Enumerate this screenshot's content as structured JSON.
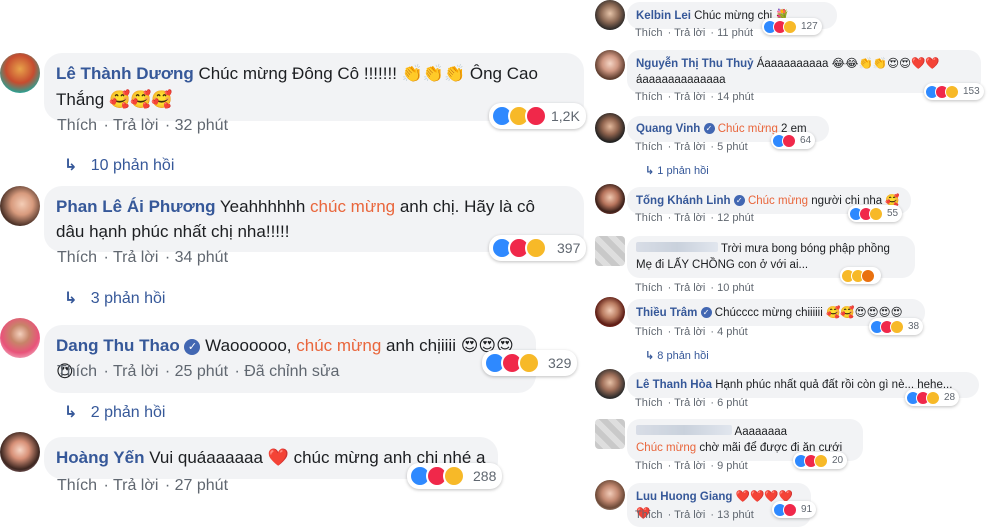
{
  "common": {
    "like": "Thích",
    "reply": "Trả lời"
  },
  "left": [
    {
      "name": "Lê Thành Dương",
      "text1": "Chúc mừng Đông Cô !!!!!!! ",
      "emoji1": "👏👏👏",
      "text2": " Ông Cao",
      "line2": "Thắng ",
      "emoji2": "🥰🥰🥰",
      "count": "1,2K",
      "time": "32 phút",
      "replies": "10 phản hồi"
    },
    {
      "name": "Phan Lê Ái Phương",
      "pre": " Yeahhhhhh ",
      "hl": "chúc mừng",
      "post": " anh chị. Hãy là cô",
      "line2": "dâu hạnh phúc nhất chị nha!!!!!",
      "count": "397",
      "time": "34 phút",
      "replies": "3 phản hồi"
    },
    {
      "name": "Dang Thu Thao",
      "pre": " Waoooooo, ",
      "hl": "chúc mừng",
      "post": " anh chịiiii ",
      "emoji": "😍😍😍😍",
      "count": "329",
      "time": "25 phút",
      "edited": "Đã chỉnh sửa",
      "replies": "2 phản hồi"
    },
    {
      "name": "Hoàng Yến",
      "text": " Vui quáaaaaaa ",
      "heart": "❤️",
      "text2": " chúc mừng anh chị nhé a",
      "count": "288",
      "time": "27 phút"
    }
  ],
  "right": [
    {
      "name": "Kelbin Lei",
      "text": " Chúc mừng chị ",
      "emoji": "💐",
      "count": "127",
      "time": "11 phút"
    },
    {
      "name": "Nguyễn Thị Thu Thuỷ",
      "text": " Áaaaaaaaaaa ",
      "emoji": "😂😂👏👏😍😍❤️❤️",
      "line2": "áaaaaaaaaaaaaa",
      "count": "153",
      "time": "14 phút"
    },
    {
      "name": "Quang Vinh",
      "hl": "Chúc mừng",
      "post": " 2 em",
      "count": "64",
      "time": "5 phút",
      "replies": "1 phản hồi"
    },
    {
      "name": "Tống Khánh Linh",
      "hl": "Chúc mừng",
      "post": " người chị nha ",
      "emoji": "🥰",
      "count": "55",
      "time": "12 phút"
    },
    {
      "line1": "Trời mưa bong bóng phập phồng",
      "line2": "Mẹ đi LẤY CHỒNG con ở với ai...",
      "time": "10 phút"
    },
    {
      "name": "Thiều Trâm",
      "text": " Chúcccc mừng chiiiiii ",
      "emoji": "🥰🥰😍😍😍😍",
      "count": "38",
      "time": "4 phút",
      "replies": "8 phản hồi"
    },
    {
      "name": "Lê Thanh Hòa",
      "text": " Hạnh phúc nhất quả đất rồi còn gì nè... hehe...",
      "count": "28",
      "time": "6 phút"
    },
    {
      "text": " Aaaaaaaa",
      "hl": "Chúc mừng",
      "post": " chờ mãi để được đi ăn cưới",
      "count": "20",
      "time": "9 phút"
    },
    {
      "name": "Luu Huong Giang",
      "emoji": "❤️❤️❤️❤️❤️",
      "count": "91",
      "time": "13 phút"
    }
  ],
  "icons": {
    "reply_arrow": "reply-arrow-icon",
    "verified": "verified-badge-icon",
    "accent": "#365899",
    "highlight": "#e9663c"
  }
}
